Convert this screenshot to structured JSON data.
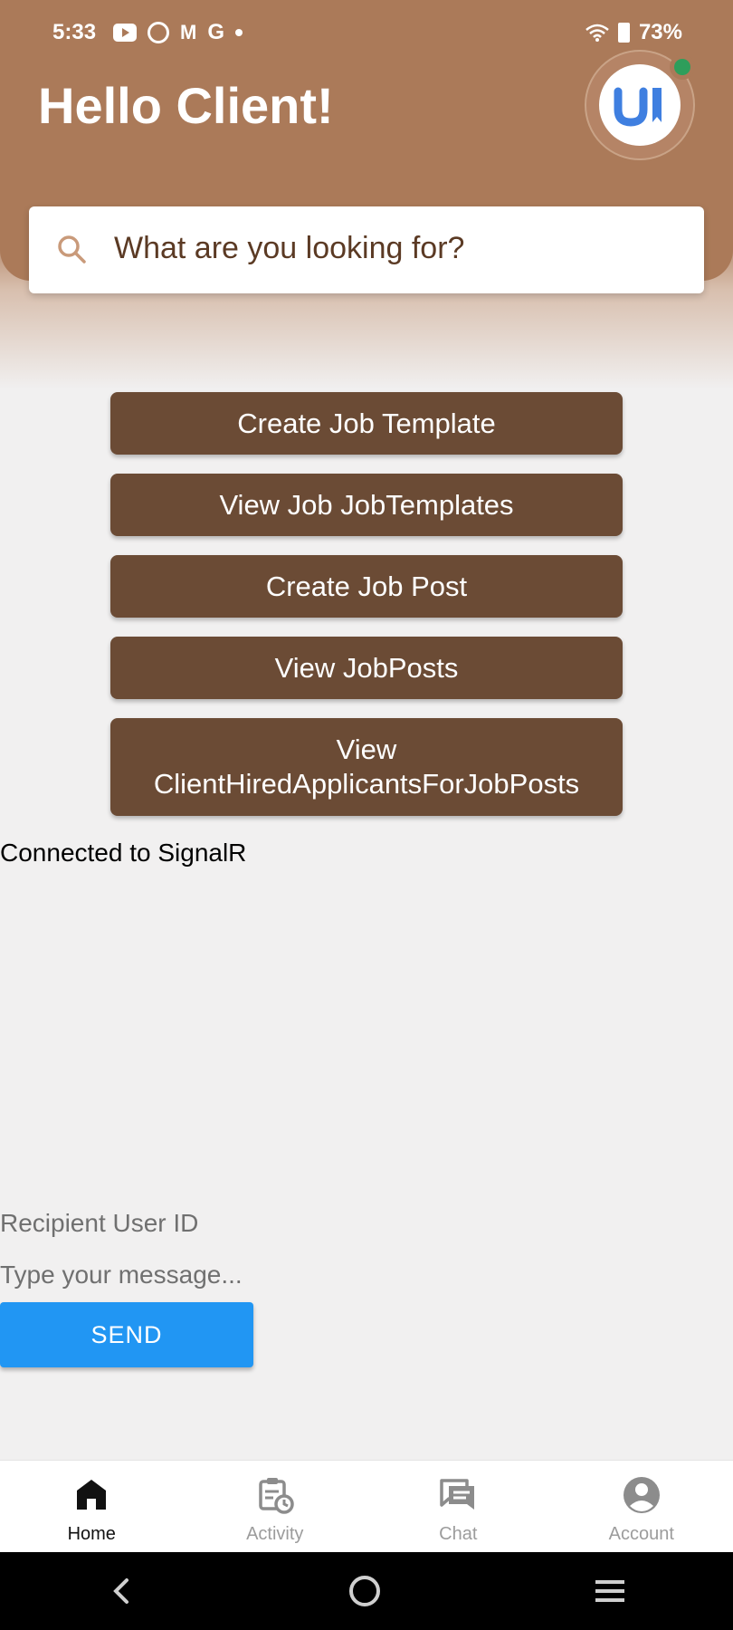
{
  "status_bar": {
    "time": "5:33",
    "left_icons": [
      "youtube-icon",
      "gallery-icon",
      "gmail-icon",
      "google-icon",
      "dot-icon"
    ],
    "gmail_glyph": "M",
    "google_glyph": "G",
    "battery": "73%"
  },
  "header": {
    "greeting": "Hello Client!",
    "avatar_text": "U"
  },
  "search": {
    "placeholder": "What are you looking for?"
  },
  "actions": {
    "create_template": "Create Job Template",
    "view_templates": "View Job JobTemplates",
    "create_post": "Create Job Post",
    "view_posts": "View JobPosts",
    "view_hired_line1": "View",
    "view_hired_line2": "ClientHiredApplicantsForJobPosts"
  },
  "chat": {
    "connection_status": "Connected to SignalR",
    "recipient_placeholder": "Recipient User ID",
    "message_placeholder": "Type your message...",
    "send_label": "SEND"
  },
  "bottom_nav": {
    "home": "Home",
    "activity": "Activity",
    "chat": "Chat",
    "account": "Account"
  },
  "colors": {
    "header": "#ab7a59",
    "button": "#6b4b35",
    "send": "#2196f3",
    "online": "#2e9e5b"
  }
}
